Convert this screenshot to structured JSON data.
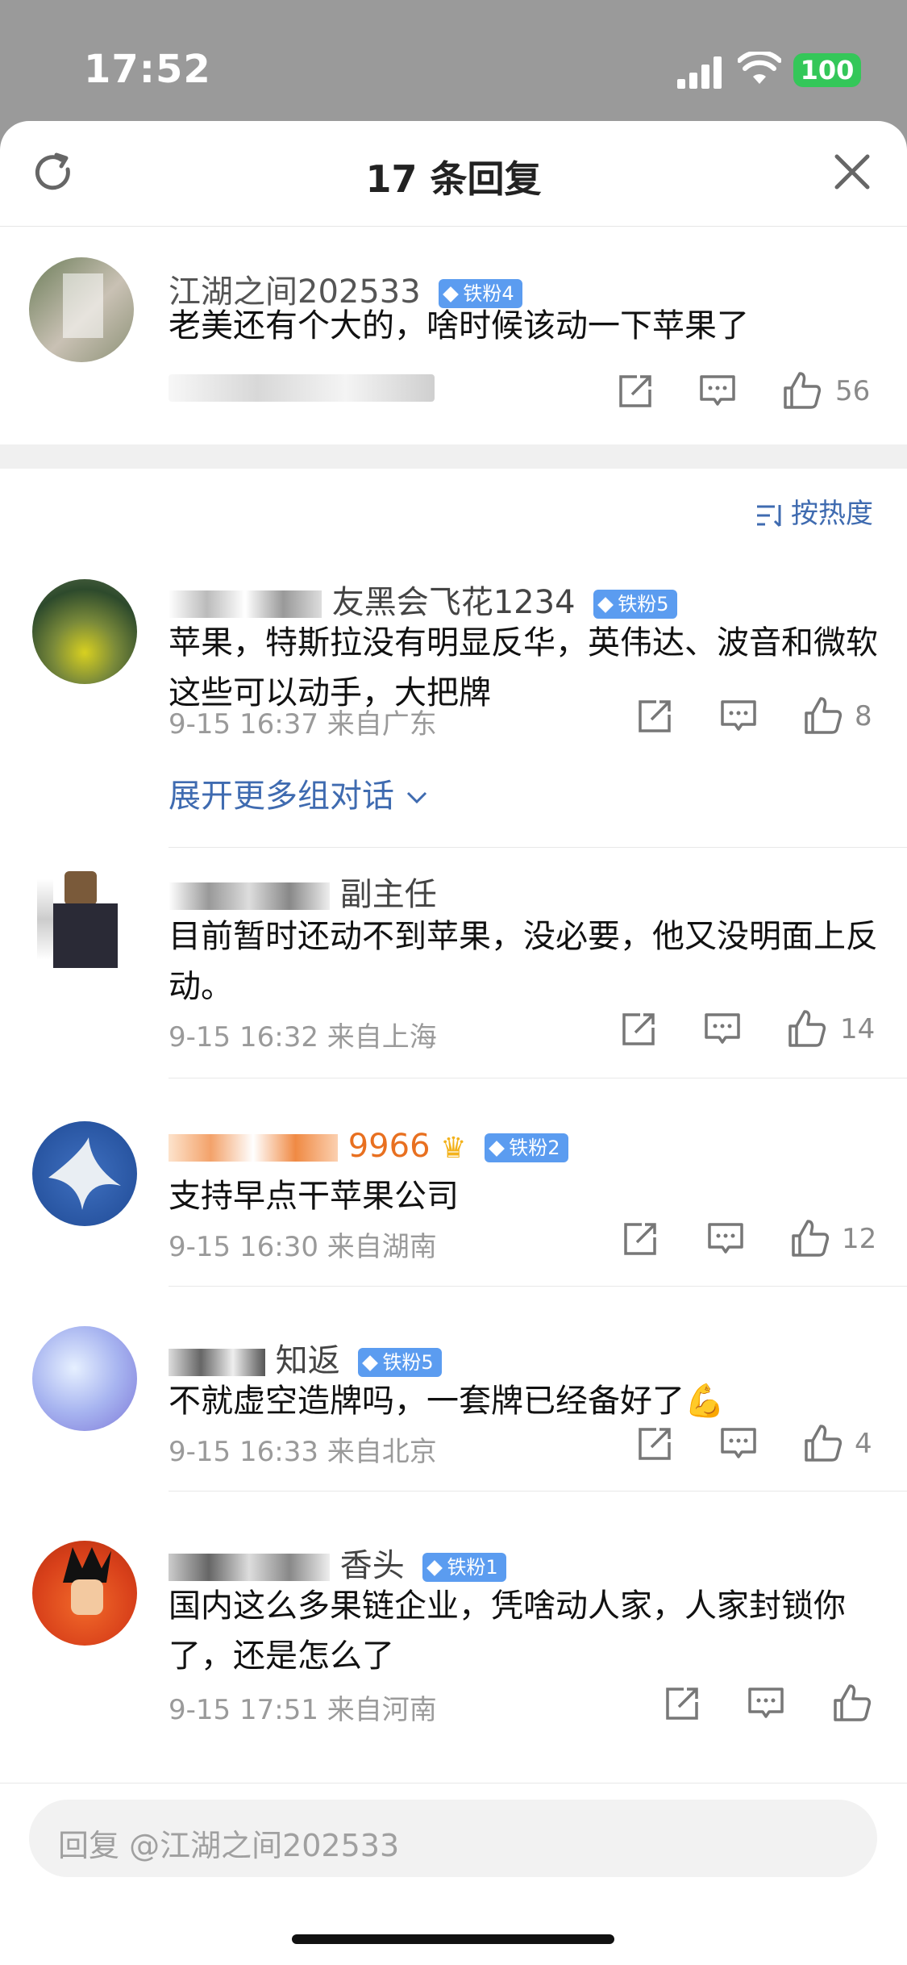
{
  "status_bar": {
    "time": "17:52",
    "battery": "100"
  },
  "header": {
    "title": "17 条回复"
  },
  "root_comment": {
    "username": "江湖之间202533",
    "badge": "铁粉4",
    "text": "老美还有个大的，啥时候该动一下苹果了",
    "likes": "56"
  },
  "sort": {
    "label": "按热度"
  },
  "replies": [
    {
      "username": "友黑会飞花1234",
      "badge": "铁粉5",
      "text": "苹果，特斯拉没有明显反华，英伟达、波音和微软这些可以动手，大把牌",
      "meta": "9-15 16:37 来自广东",
      "likes": "8",
      "expand": "展开更多组对话"
    },
    {
      "username": "副主任",
      "badge": "",
      "text": "目前暂时还动不到苹果，没必要，他又没明面上反动。",
      "meta": "9-15 16:32 来自上海",
      "likes": "14"
    },
    {
      "username": "9966",
      "badge": "铁粉2",
      "text": "支持早点干苹果公司",
      "meta": "9-15 16:30 来自湖南",
      "likes": "12"
    },
    {
      "username": "知返",
      "badge": "铁粉5",
      "text": "不就虚空造牌吗，一套牌已经备好了💪",
      "meta": "9-15 16:33 来自北京",
      "likes": "4"
    },
    {
      "username": "香头",
      "badge": "铁粉1",
      "text": "国内这么多果链企业，凭啥动人家，人家封锁你了，还是怎么了",
      "meta": "9-15 17:51 来自河南",
      "likes": ""
    }
  ],
  "reply_input": {
    "placeholder": "回复 @江湖之间202533"
  }
}
